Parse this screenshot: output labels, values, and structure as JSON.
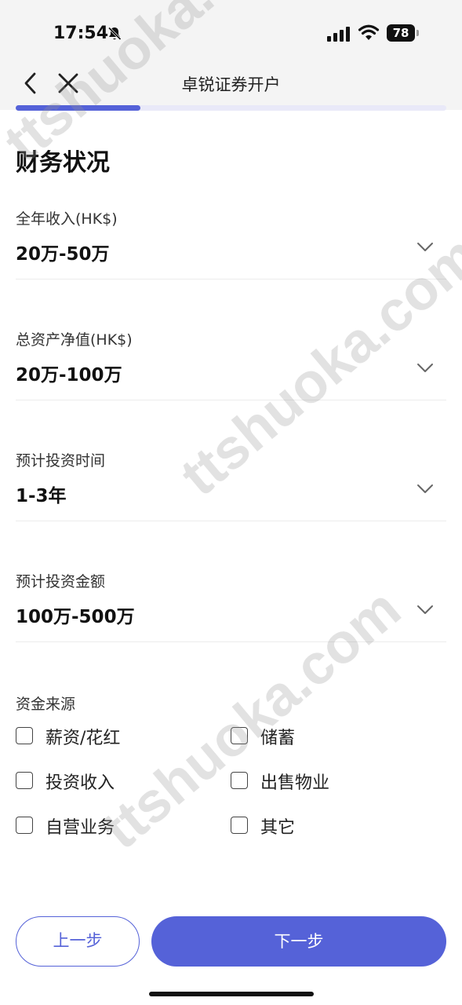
{
  "status_bar": {
    "time": "17:54",
    "battery": "78"
  },
  "nav": {
    "title": "卓锐证券开户"
  },
  "progress": {
    "fraction": 0.29
  },
  "section": {
    "title": "财务状况"
  },
  "fields": [
    {
      "label": "全年收入(HK$)",
      "value": "20万-50万"
    },
    {
      "label": "总资产净值(HK$)",
      "value": "20万-100万"
    },
    {
      "label": "预计投资时间",
      "value": "1-3年"
    },
    {
      "label": "预计投资金额",
      "value": "100万-500万"
    }
  ],
  "fund_sources": {
    "label": "资金来源",
    "options": [
      {
        "label": "薪资/花红",
        "checked": false
      },
      {
        "label": "储蓄",
        "checked": false
      },
      {
        "label": "投资收入",
        "checked": false
      },
      {
        "label": "出售物业",
        "checked": false
      },
      {
        "label": "自营业务",
        "checked": false
      },
      {
        "label": "其它",
        "checked": false
      }
    ]
  },
  "buttons": {
    "prev": "上一步",
    "next": "下一步"
  },
  "watermark": "ttshuoka.com",
  "colors": {
    "accent": "#5562d8",
    "progress_track": "#e9e9f8"
  }
}
